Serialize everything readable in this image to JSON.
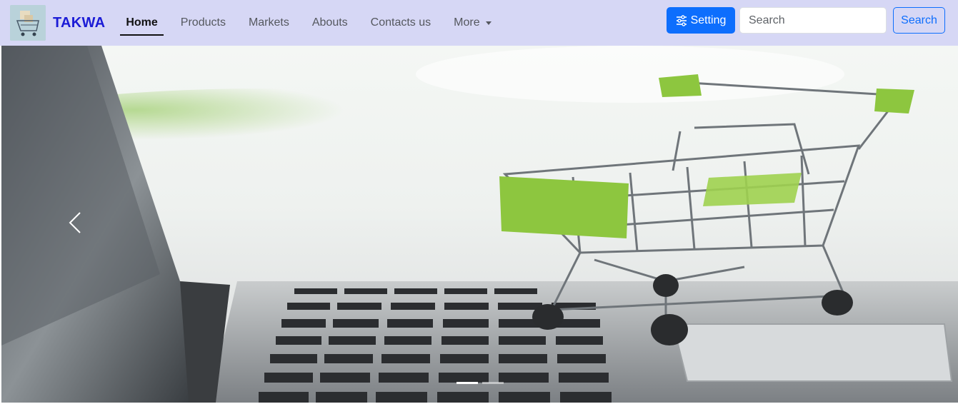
{
  "brand": {
    "name": "TAKWA",
    "logo_icon": "shopping-cart-icon"
  },
  "nav": {
    "items": [
      {
        "label": "Home",
        "active": true
      },
      {
        "label": "Products",
        "active": false
      },
      {
        "label": "Markets",
        "active": false
      },
      {
        "label": "Abouts",
        "active": false
      },
      {
        "label": "Contacts us",
        "active": false
      },
      {
        "label": "More",
        "active": false,
        "dropdown": true
      }
    ]
  },
  "toolbar": {
    "setting_label": "Setting",
    "setting_icon": "sliders-icon",
    "search_placeholder": "Search",
    "search_button_label": "Search"
  },
  "carousel": {
    "prev_icon": "chevron-left-icon",
    "indicator_count": 2,
    "active_indicator": 1
  },
  "colors": {
    "navbar_bg": "#d6d7f5",
    "brand": "#1b1bd6",
    "primary": "#0d6efd",
    "cart_green": "#8dc63f"
  }
}
